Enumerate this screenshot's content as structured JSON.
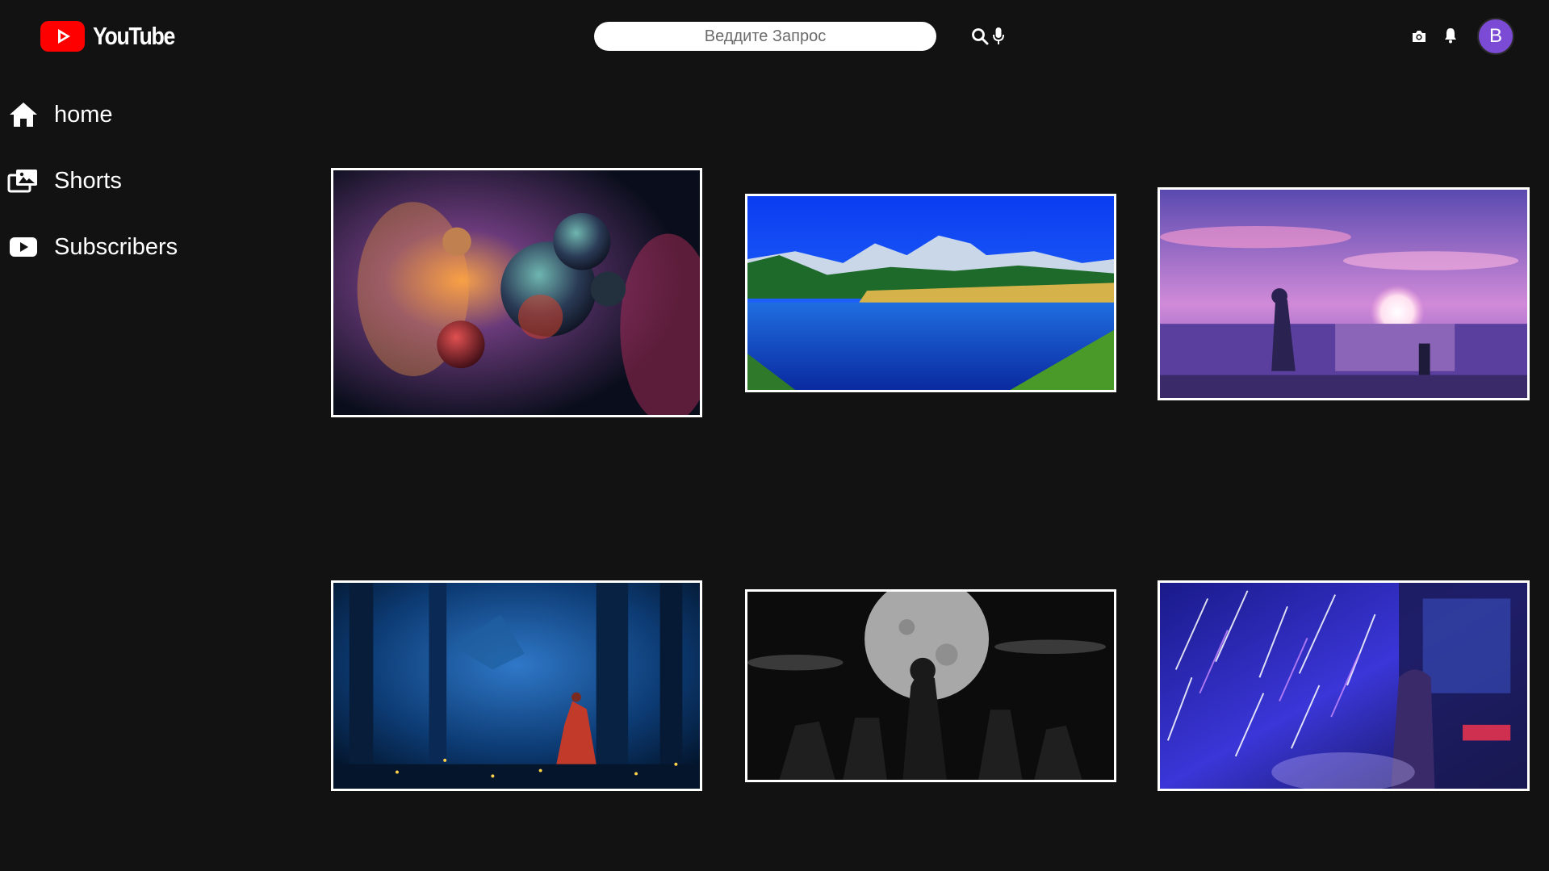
{
  "header": {
    "logo_text": "YouTube",
    "search_placeholder": "Веддите Запрос",
    "avatar_letter": "B",
    "icons": [
      "search-icon",
      "microphone-icon",
      "camera-icon",
      "bell-icon"
    ]
  },
  "sidebar": {
    "items": [
      {
        "label": "home",
        "icon": "home-icon"
      },
      {
        "label": "Shorts",
        "icon": "shorts-icon"
      },
      {
        "label": "Subscribers",
        "icon": "subscriptions-icon"
      }
    ]
  },
  "videos": [
    {
      "thumbnail": "space-planets-nebula"
    },
    {
      "thumbnail": "mountain-lake-landscape"
    },
    {
      "thumbnail": "anime-sunset-girl-bicycle"
    },
    {
      "thumbnail": "blue-forest-dragon"
    },
    {
      "thumbnail": "black-white-full-moon-silhouettes"
    },
    {
      "thumbnail": "anime-meteor-shower"
    }
  ],
  "colors": {
    "background": "#121212",
    "logo_red": "#ff0000",
    "avatar": "#7b4bd6",
    "thumb_border": "#ffffff"
  }
}
